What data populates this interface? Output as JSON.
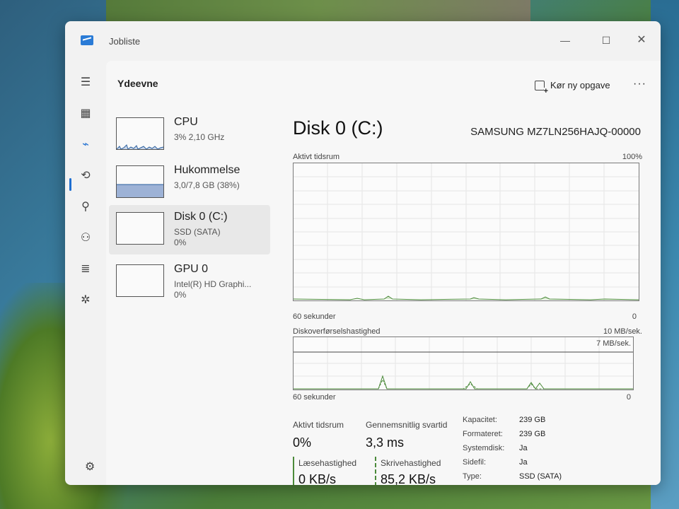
{
  "window": {
    "title": "Jobliste",
    "controls": {
      "minimize": "—",
      "maximize": "☐",
      "close": "✕"
    }
  },
  "nav": [
    {
      "name": "hamburger-menu-icon",
      "glyph": "☰"
    },
    {
      "name": "processes-icon",
      "glyph": "▦"
    },
    {
      "name": "performance-icon",
      "glyph": "⌁"
    },
    {
      "name": "app-history-icon",
      "glyph": "⟲"
    },
    {
      "name": "startup-apps-icon",
      "glyph": "⚲"
    },
    {
      "name": "users-icon",
      "glyph": "⚇"
    },
    {
      "name": "details-icon",
      "glyph": "≣"
    },
    {
      "name": "services-icon",
      "glyph": "✲"
    }
  ],
  "header": {
    "page_title": "Ydeevne",
    "run_task_label": "Kør ny opgave",
    "more_label": "···"
  },
  "devices": [
    {
      "name": "CPU",
      "sub": "3% 2,10 GHz",
      "sub2": ""
    },
    {
      "name": "Hukommelse",
      "sub": "3,0/7,8 GB (38%)",
      "sub2": ""
    },
    {
      "name": "Disk 0 (C:)",
      "sub": "SSD (SATA)",
      "sub2": "0%"
    },
    {
      "name": "GPU 0",
      "sub": "Intel(R) HD Graphi...",
      "sub2": "0%"
    }
  ],
  "main": {
    "title": "Disk 0 (C:)",
    "model": "SAMSUNG MZ7LN256HAJQ-00000",
    "active_graph": {
      "label": "Aktivt tidsrum",
      "max_label": "100%",
      "x_left": "60 sekunder",
      "x_right": "0"
    },
    "transfer_graph": {
      "label": "Diskoverførselshastighed",
      "max_label": "10 MB/sek.",
      "ref_label": "7 MB/sek.",
      "x_left": "60 sekunder",
      "x_right": "0"
    }
  },
  "stats": {
    "active_label": "Aktivt tidsrum",
    "active_value": "0%",
    "resp_label": "Gennemsnitlig svartid",
    "resp_value": "3,3 ms",
    "read_label": "Læsehastighed",
    "read_value": "0 KB/s",
    "write_label": "Skrivehastighed",
    "write_value": "85,2 KB/s"
  },
  "properties": [
    {
      "key": "Kapacitet:",
      "value": "239 GB"
    },
    {
      "key": "Formateret:",
      "value": "239 GB"
    },
    {
      "key": "Systemdisk:",
      "value": "Ja"
    },
    {
      "key": "Sidefil:",
      "value": "Ja"
    },
    {
      "key": "Type:",
      "value": "SSD (SATA)"
    }
  ],
  "colors": {
    "accent": "#1f6fd1",
    "disk_line": "#4b8a3a",
    "memory_fill": "#9db2d6",
    "cpu_line": "#2b5f9e"
  }
}
